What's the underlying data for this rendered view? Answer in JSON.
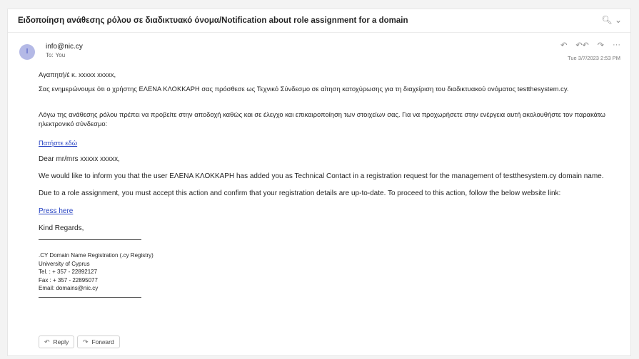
{
  "subject": "Ειδοποίηση ανάθεσης ρόλου σε διαδικτυακό όνομα/Notification about role assignment for a domain",
  "toolbar": {
    "zoom_icon": "🔍︎",
    "zoom_chevron": "⌄"
  },
  "sender": {
    "initial": "I",
    "email": "info@nic.cy",
    "to_label": "To:",
    "to_value": "You",
    "timestamp": "Tue 3/7/2023 2:53 PM",
    "avatar_color": "#b4b9e6"
  },
  "actions": {
    "reply_icon": "↶",
    "reply_all_icon": "↶↶",
    "forward_icon": "↷",
    "more_icon": "···"
  },
  "body": {
    "greek_greeting": "Αγαπητή/έ κ. xxxxx xxxxx,",
    "greek_p1": "Σας ενημερώνουμε ότι ο χρήστης ΕΛΕΝΑ ΚΛΟΚΚΑΡΗ σας πρόσθεσε ως Τεχνικό Σύνδεσμο σε αίτηση κατοχύρωσης για τη διαχείριση του διαδικτυακού ονόματος testthesystem.cy.",
    "greek_p2": "Λόγω της ανάθεσης ρόλου πρέπει να προβείτε στην αποδοχή καθώς και σε έλεγχο και επικαιροποίηση των στοιχείων σας. Για να προχωρήσετε στην ενέργεια αυτή ακολουθήστε τον παρακάτω ηλεκτρονικό σύνδεσμο:",
    "greek_link": "Πατήστε εδώ",
    "en_greeting": "Dear mr/mrs xxxxx xxxxx,",
    "en_p1": "We would like to inform you that the user ΕΛΕΝΑ ΚΛΟΚΚΑΡΗ has added you as Technical Contact in a registration request for the management of testthesystem.cy domain name.",
    "en_p2": "Due to a role assignment, you must accept this action and confirm that your registration details are up-to-date. To proceed to this action, follow the below website link:",
    "en_link": "Press here",
    "closing": "Kind Regards,"
  },
  "signature": {
    "line1": ".CY Domain Name Registration (.cy Registry)",
    "line2": "University of Cyprus",
    "line3": "Tel. : + 357 - 22892127",
    "line4": "Fax : + 357 - 22895077",
    "line5": "Email: domains@nic.cy"
  },
  "buttons": {
    "reply_label": "Reply",
    "forward_label": "Forward",
    "reply_icon": "↶",
    "forward_icon": "↷"
  }
}
